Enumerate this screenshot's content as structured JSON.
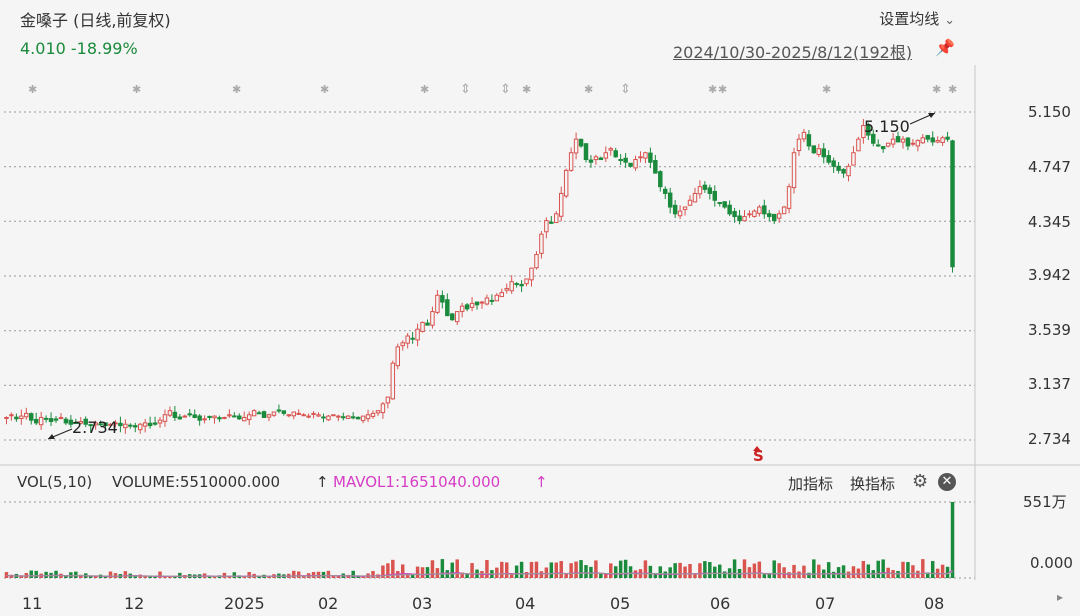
{
  "header": {
    "title": "金嗓子 (日线,前复权)",
    "price_change": "4.010 -18.99%",
    "settings_label": "设置均线",
    "settings_chevron": "⌄",
    "date_range": "2024/10/30-2025/8/12(192根)",
    "pin_icon": "pin-icon"
  },
  "volume_panel": {
    "name": "VOL(5,10)",
    "volume_text": "VOLUME:5510000.000",
    "mavol_text": "MAVOL1:1651040.000",
    "arrow_up": "↑",
    "add_indicator": "加指标",
    "swap_indicator": "换指标",
    "gear_icon": "gear-icon",
    "close_icon": "close-icon",
    "y_top_label": "551万",
    "y_bottom_label": "0.000"
  },
  "colors": {
    "up": "#d9534f",
    "down": "#1a8a3c",
    "ma_pink": "#d63cc5",
    "ma_gray": "#999999",
    "grid": "#999999",
    "marker_red": "#cc2222"
  },
  "markers": {
    "high_label": "5.150",
    "low_label": "2.734",
    "s_marker": "S"
  },
  "chart_data": {
    "type": "candlestick",
    "title": "金嗓子 (日线,前复权)",
    "y_ticks": [
      "5.150",
      "4.747",
      "4.345",
      "3.942",
      "3.539",
      "3.137",
      "2.734"
    ],
    "ylim": [
      2.734,
      5.15
    ],
    "x_ticks": [
      "11",
      "12",
      "2025",
      "02",
      "03",
      "04",
      "05",
      "06",
      "07",
      "08"
    ],
    "num_bars": 192,
    "last_close": 4.01,
    "change_pct": -18.99,
    "period_high": 5.15,
    "period_low": 2.734,
    "last_volume": 5510000,
    "mavol1": 1651040,
    "volume_ylim": [
      0,
      5510000
    ],
    "close_series": [
      2.9,
      2.92,
      2.89,
      2.91,
      2.93,
      2.88,
      2.86,
      2.9,
      2.89,
      2.87,
      2.88,
      2.9,
      2.86,
      2.85,
      2.86,
      2.87,
      2.85,
      2.84,
      2.86,
      2.85,
      2.84,
      2.85,
      2.86,
      2.84,
      2.85,
      2.84,
      2.83,
      2.85,
      2.86,
      2.84,
      2.85,
      2.88,
      2.92,
      2.95,
      2.9,
      2.89,
      2.91,
      2.92,
      2.9,
      2.88,
      2.89,
      2.9,
      2.91,
      2.89,
      2.9,
      2.92,
      2.91,
      2.89,
      2.9,
      2.92,
      2.95,
      2.93,
      2.9,
      2.92,
      2.94,
      2.95,
      2.93,
      2.92,
      2.94,
      2.93,
      2.92,
      2.91,
      2.93,
      2.92,
      2.9,
      2.91,
      2.92,
      2.91,
      2.9,
      2.91,
      2.9,
      2.89,
      2.91,
      2.92,
      2.93,
      2.95,
      3.0,
      3.05,
      3.3,
      3.42,
      3.45,
      3.5,
      3.48,
      3.55,
      3.6,
      3.58,
      3.68,
      3.8,
      3.75,
      3.65,
      3.62,
      3.68,
      3.72,
      3.7,
      3.74,
      3.73,
      3.75,
      3.78,
      3.76,
      3.8,
      3.82,
      3.85,
      3.9,
      3.88,
      3.87,
      3.92,
      4.0,
      4.1,
      4.25,
      4.35,
      4.33,
      4.4,
      4.55,
      4.72,
      4.85,
      4.95,
      4.9,
      4.8,
      4.78,
      4.82,
      4.8,
      4.85,
      4.88,
      4.82,
      4.8,
      4.78,
      4.75,
      4.8,
      4.82,
      4.85,
      4.78,
      4.7,
      4.6,
      4.55,
      4.45,
      4.4,
      4.42,
      4.45,
      4.5,
      4.55,
      4.6,
      4.58,
      4.55,
      4.5,
      4.48,
      4.45,
      4.4,
      4.38,
      4.35,
      4.38,
      4.4,
      4.42,
      4.45,
      4.4,
      4.38,
      4.35,
      4.4,
      4.45,
      4.6,
      4.85,
      4.95,
      5.0,
      4.9,
      4.85,
      4.88,
      4.82,
      4.78,
      4.75,
      4.72,
      4.7,
      4.75,
      4.85,
      4.95,
      5.05,
      4.98,
      4.92,
      4.9,
      4.88,
      4.92,
      4.95,
      4.93,
      4.95,
      4.9,
      4.92,
      4.94,
      4.96,
      4.95,
      4.93,
      4.94,
      4.96,
      4.95,
      4.01
    ]
  }
}
